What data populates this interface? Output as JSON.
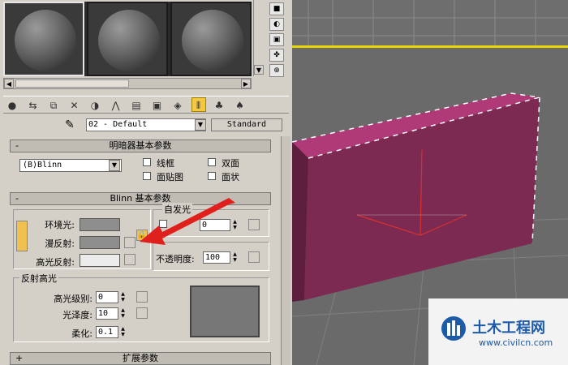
{
  "material_editor": {
    "right_side_buttons": [
      "■",
      "◐",
      "▣",
      "✤",
      "⊕"
    ],
    "toolbar_icons": [
      "sphere-pick-icon",
      "put-to-scene-icon",
      "assign-material-icon",
      "reset-icon",
      "copy-icon",
      "unique-icon",
      "put-library-icon",
      "effect-channel-icon",
      "show-map-icon",
      "show-end-icon",
      "go-parent-icon",
      "go-sibling-icon",
      "pick-icon"
    ],
    "name_field": "02 - Default",
    "type_button": "Standard",
    "shader_rollout": {
      "collapse_symbol": "-",
      "title": "明暗器基本参数",
      "shader_select": "(B)Blinn",
      "checkboxes": [
        {
          "label": "线框",
          "checked": false
        },
        {
          "label": "双面",
          "checked": false
        },
        {
          "label": "面贴图",
          "checked": false
        },
        {
          "label": "面状",
          "checked": false
        }
      ]
    },
    "blinn_rollout": {
      "collapse_symbol": "-",
      "title": "Blinn 基本参数",
      "ambient_label": "环境光:",
      "diffuse_label": "漫反射:",
      "specular_label": "高光反射:",
      "self_illum_group": "自发光",
      "self_illum_value": "0",
      "opacity_label": "不透明度:",
      "opacity_value": "100",
      "specular_highlights_group": "反射高光",
      "specular_level_label": "高光级别:",
      "specular_level_value": "0",
      "glossiness_label": "光泽度:",
      "glossiness_value": "10",
      "soften_label": "柔化:",
      "soften_value": "0.1"
    },
    "extended_rollout": {
      "collapse_symbol": "+",
      "title": "扩展参数"
    }
  },
  "watermark": {
    "name": "土木工程网",
    "url": "www.civilcn.com"
  },
  "colors": {
    "box_front": "#7d2a52",
    "box_top": "#b03a78",
    "highlight_arrow": "#e0201c"
  }
}
